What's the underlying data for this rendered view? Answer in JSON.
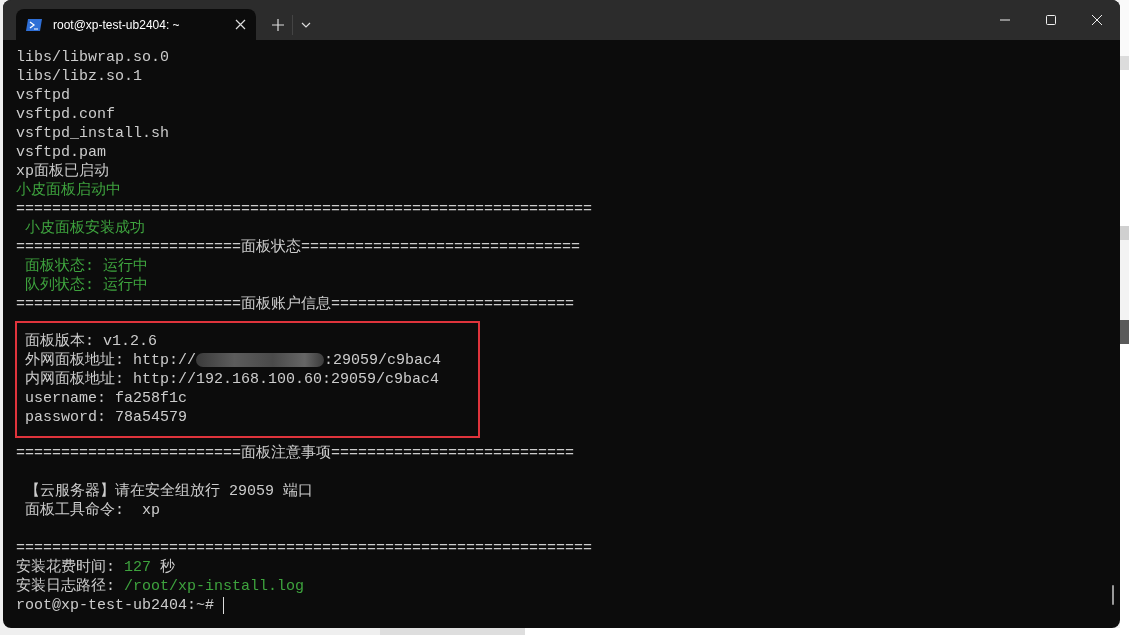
{
  "window": {
    "tab": {
      "title": "root@xp-test-ub2404: ~",
      "selected": true
    }
  },
  "lines": [
    {
      "kind": "text",
      "segments": [
        {
          "text": "libs/libwrap.so.0",
          "color": "#cccccc"
        }
      ]
    },
    {
      "kind": "text",
      "segments": [
        {
          "text": "libs/libz.so.1",
          "color": "#cccccc"
        }
      ]
    },
    {
      "kind": "text",
      "segments": [
        {
          "text": "vsftpd",
          "color": "#cccccc"
        }
      ]
    },
    {
      "kind": "text",
      "segments": [
        {
          "text": "vsftpd.conf",
          "color": "#cccccc"
        }
      ]
    },
    {
      "kind": "text",
      "segments": [
        {
          "text": "vsftpd_install.sh",
          "color": "#cccccc"
        }
      ]
    },
    {
      "kind": "text",
      "segments": [
        {
          "text": "vsftpd.pam",
          "color": "#cccccc"
        }
      ]
    },
    {
      "kind": "text",
      "segments": [
        {
          "text": "xp面板已启动",
          "color": "#cccccc"
        }
      ]
    },
    {
      "kind": "text",
      "segments": [
        {
          "text": "小皮面板启动中",
          "color": "#3ea33e"
        }
      ]
    },
    {
      "kind": "text",
      "segments": [
        {
          "text": "================================================================",
          "color": "#cccccc"
        }
      ]
    },
    {
      "kind": "text",
      "segments": [
        {
          "text": " 小皮面板安装成功",
          "color": "#3ea33e"
        }
      ]
    },
    {
      "kind": "text",
      "segments": [
        {
          "text": "=========================面板状态===============================",
          "color": "#cccccc"
        }
      ]
    },
    {
      "kind": "text",
      "segments": [
        {
          "text": " 面板状态: 运行中",
          "color": "#3ea33e"
        }
      ]
    },
    {
      "kind": "text",
      "segments": [
        {
          "text": " 队列状态: 运行中",
          "color": "#3ea33e"
        }
      ]
    },
    {
      "kind": "text",
      "segments": [
        {
          "text": "=========================面板账户信息===========================",
          "color": "#cccccc"
        }
      ]
    },
    {
      "kind": "box",
      "lines": [
        {
          "kind": "text",
          "segments": [
            {
              "text": "面板版本: v1.2.6",
              "color": "#cccccc"
            }
          ]
        },
        {
          "kind": "text",
          "segments": [
            {
              "text": "外网面板地址: http://",
              "color": "#cccccc"
            },
            {
              "kind": "redacted"
            },
            {
              "text": ":29059/c9bac4",
              "color": "#cccccc"
            }
          ]
        },
        {
          "kind": "text",
          "segments": [
            {
              "text": "内网面板地址: http://192.168.100.60:29059/c9bac4",
              "color": "#cccccc"
            }
          ]
        },
        {
          "kind": "text",
          "segments": [
            {
              "text": "username: fa258f1c",
              "color": "#cccccc"
            }
          ]
        },
        {
          "kind": "text",
          "segments": [
            {
              "text": "password: 78a54579",
              "color": "#cccccc"
            }
          ]
        }
      ]
    },
    {
      "kind": "text",
      "segments": [
        {
          "text": "=========================面板注意事项===========================",
          "color": "#cccccc"
        }
      ]
    },
    {
      "kind": "blank"
    },
    {
      "kind": "text",
      "segments": [
        {
          "text": " 【云服务器】请在安全组放行 29059 端口",
          "color": "#cccccc"
        }
      ]
    },
    {
      "kind": "text",
      "segments": [
        {
          "text": " 面板工具命令:  xp",
          "color": "#cccccc"
        }
      ]
    },
    {
      "kind": "blank"
    },
    {
      "kind": "text",
      "segments": [
        {
          "text": "================================================================",
          "color": "#cccccc"
        }
      ]
    },
    {
      "kind": "text",
      "segments": [
        {
          "text": "安装花费时间: ",
          "color": "#cccccc"
        },
        {
          "text": "127",
          "color": "#3ea33e"
        },
        {
          "text": " 秒",
          "color": "#cccccc"
        }
      ]
    },
    {
      "kind": "text",
      "segments": [
        {
          "text": "安装日志路径: ",
          "color": "#cccccc"
        },
        {
          "text": "/root/xp-install.log",
          "color": "#3ea33e"
        }
      ]
    },
    {
      "kind": "text",
      "segments": [
        {
          "text": "root@xp-test-ub2404:~# ",
          "color": "#cccccc"
        },
        {
          "kind": "cursor"
        }
      ]
    }
  ]
}
